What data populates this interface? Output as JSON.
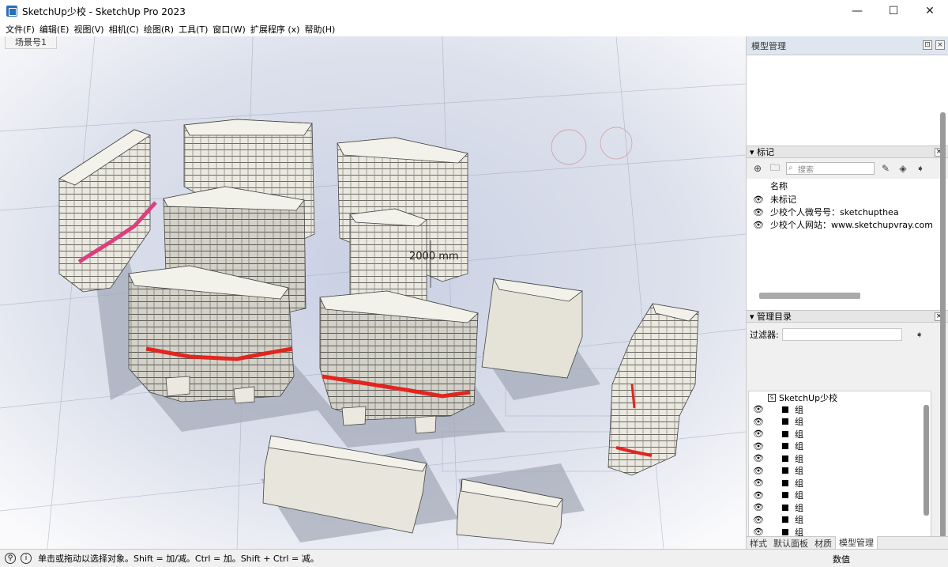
{
  "window": {
    "title": "SketchUp少校 - SketchUp Pro 2023",
    "minimize": "—",
    "maximize": "☐",
    "close": "✕"
  },
  "menu": [
    "文件(F)",
    "编辑(E)",
    "视图(V)",
    "相机(C)",
    "绘图(R)",
    "工具(T)",
    "窗口(W)",
    "扩展程序 (x)",
    "帮助(H)"
  ],
  "viewport": {
    "scene_tab": "场景号1",
    "dimension_label": "2000 mm"
  },
  "tray": {
    "title": "模型管理"
  },
  "tags": {
    "section_title": "标记",
    "search_placeholder": "搜索",
    "column_name": "名称",
    "rows": [
      "未标记",
      "少校个人微号号：sketchupthea",
      "少校个人网站：www.sketchupvray.com"
    ]
  },
  "outliner": {
    "section_title": "管理目录",
    "filter_label": "过滤器:",
    "root": "SketchUp少校",
    "item_label": "组",
    "item_count": 11
  },
  "bottom_tabs": [
    "样式",
    "默认面板",
    "材质",
    "模型管理"
  ],
  "status": {
    "message": "单击或拖动以选择对象。Shift = 加/减。Ctrl = 加。Shift + Ctrl = 减。",
    "measurement_label": "数值"
  },
  "colors": {
    "band_red": "#e0261f",
    "band_pink": "#d9407e",
    "building": "#ecebe2"
  }
}
